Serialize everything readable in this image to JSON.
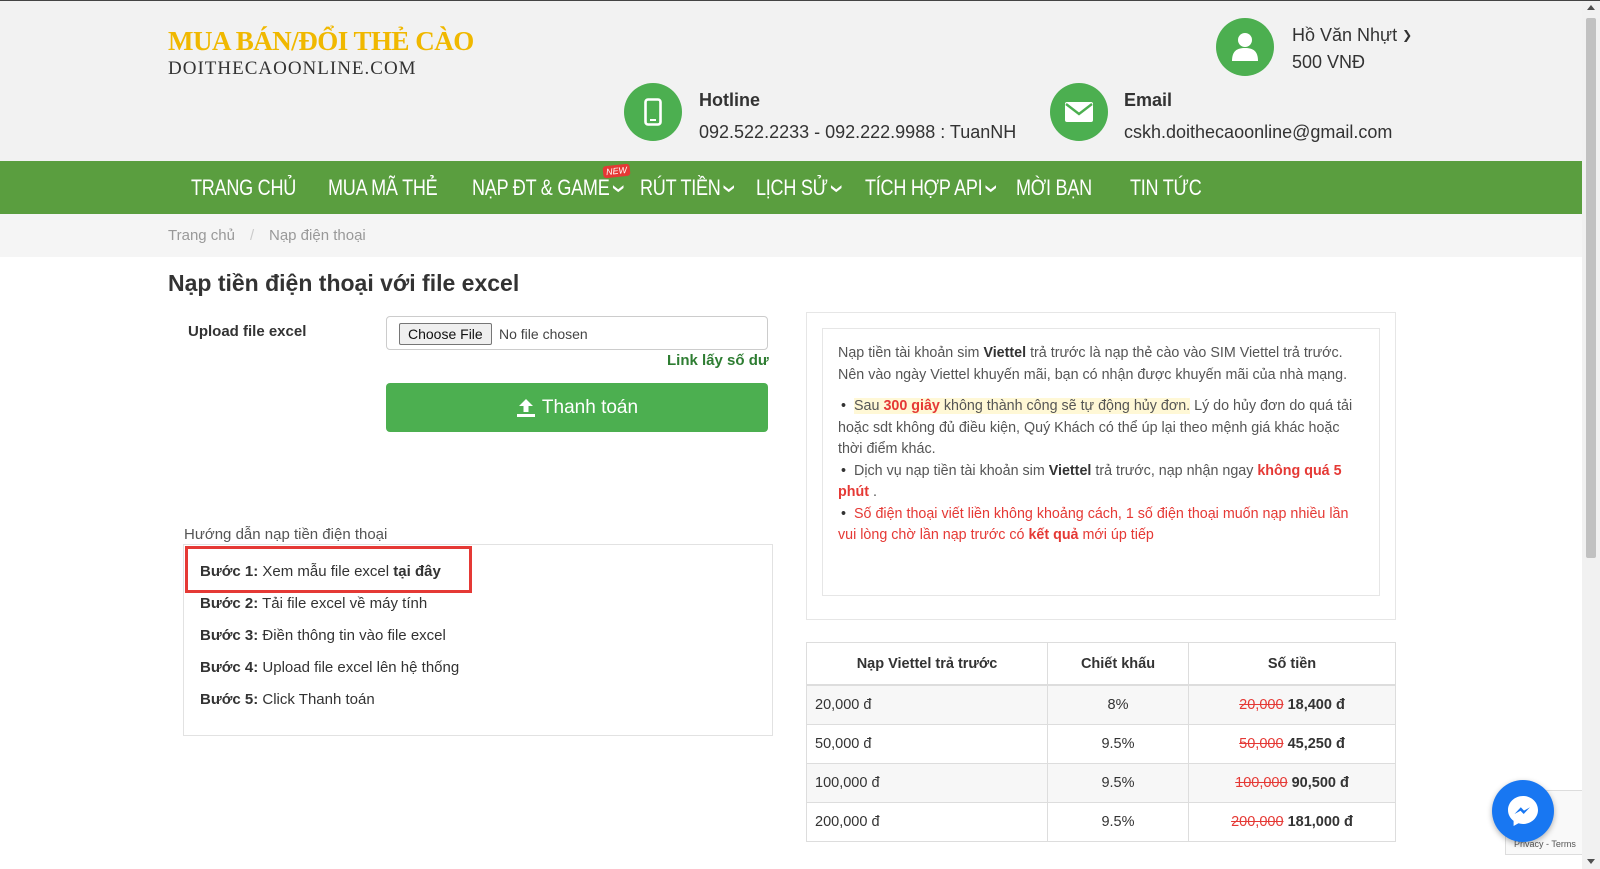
{
  "header": {
    "logo_main": "MUA BÁN/ĐỔI THẺ CÀO",
    "logo_sub": "DOITHECAOONLINE.COM",
    "hotline_title": "Hotline",
    "hotline_value": "092.522.2233 - 092.222.9988 : TuanNH",
    "email_title": "Email",
    "email_value": "cskh.doithecaoonline@gmail.com",
    "user_name": "Hồ Văn Nhựt",
    "user_balance": "500 VNĐ"
  },
  "nav": {
    "items": [
      {
        "label": "TRANG CHỦ"
      },
      {
        "label": "MUA MÃ THẺ"
      },
      {
        "label": "NẠP ĐT & GAME"
      },
      {
        "label": "RÚT TIỀN"
      },
      {
        "label": "LỊCH SỬ"
      },
      {
        "label": "TÍCH HỢP API"
      },
      {
        "label": "MỜI BẠN"
      },
      {
        "label": "TIN TỨC"
      }
    ],
    "new_badge": "NEW"
  },
  "breadcrumb": {
    "home": "Trang chủ",
    "separator": "/",
    "current": "Nạp điện thoại"
  },
  "form": {
    "page_title": "Nạp tiền điện thoại với file excel",
    "upload_label": "Upload file excel",
    "choose_file": "Choose File",
    "file_status": "No file chosen",
    "balance_link": "Link lấy số dư",
    "pay_button": "Thanh toán"
  },
  "guide": {
    "title": "Hướng dẫn nạp tiền điện thoại",
    "steps": [
      {
        "label": "Bước 1:",
        "text": "Xem mẫu file excel ",
        "bold": "tại đây"
      },
      {
        "label": "Bước 2:",
        "text": "Tải file excel về máy tính"
      },
      {
        "label": "Bước 3:",
        "text": "Điền thông tin vào file excel"
      },
      {
        "label": "Bước 4:",
        "text": "Upload file excel lên hệ thống"
      },
      {
        "label": "Bước 5:",
        "text": "Click Thanh toán"
      }
    ]
  },
  "info": {
    "intro_1": "Nạp tiền tài khoản sim ",
    "intro_brand": "Viettel",
    "intro_2": " trả trước là nạp thẻ cào vào SIM Viettel trả trước. Nên vào ngày Viettel khuyến mãi, bạn có nhận được khuyến mãi của nhà mạng.",
    "b1_1": "Sau ",
    "b1_time": "300 giây",
    "b1_2": " không thành công sẽ tự động hủy đơn.",
    "b1_3": " Lý do hủy đơn do quá tải hoặc sdt không đủ điều kiện, Quý Khách có thể úp lại theo mệnh giá khác hoặc thời điểm khác.",
    "b2_1": "Dịch vụ nạp tiền tài khoản sim ",
    "b2_brand": "Viettel",
    "b2_2": " trả trước, nạp nhận ngay ",
    "b2_time": "không quá 5 phút",
    "b2_3": " .",
    "b3_1": "Số điện thoại viết liền không khoảng cách, 1 số điện thoại muốn nạp nhiều lần vui lòng chờ lần nạp trước có ",
    "b3_bold": "kết quả",
    "b3_2": " mới úp tiếp"
  },
  "price_table": {
    "headers": [
      "Nạp Viettel trả trước",
      "Chiết khấu",
      "Số tiền"
    ],
    "rows": [
      {
        "denom": "20,000 đ",
        "discount": "8%",
        "old": "20,000",
        "new": "18,400 đ"
      },
      {
        "denom": "50,000 đ",
        "discount": "9.5%",
        "old": "50,000",
        "new": "45,250 đ"
      },
      {
        "denom": "100,000 đ",
        "discount": "9.5%",
        "old": "100,000",
        "new": "90,500 đ"
      },
      {
        "denom": "200,000 đ",
        "discount": "9.5%",
        "old": "200,000",
        "new": "181,000 đ"
      }
    ]
  },
  "recaptcha": {
    "text": "Privacy - Terms"
  },
  "colors": {
    "brand_green": "#5a9e3f",
    "button_green": "#4caf50",
    "logo_yellow": "#f0b800",
    "alert_red": "#e53935"
  }
}
